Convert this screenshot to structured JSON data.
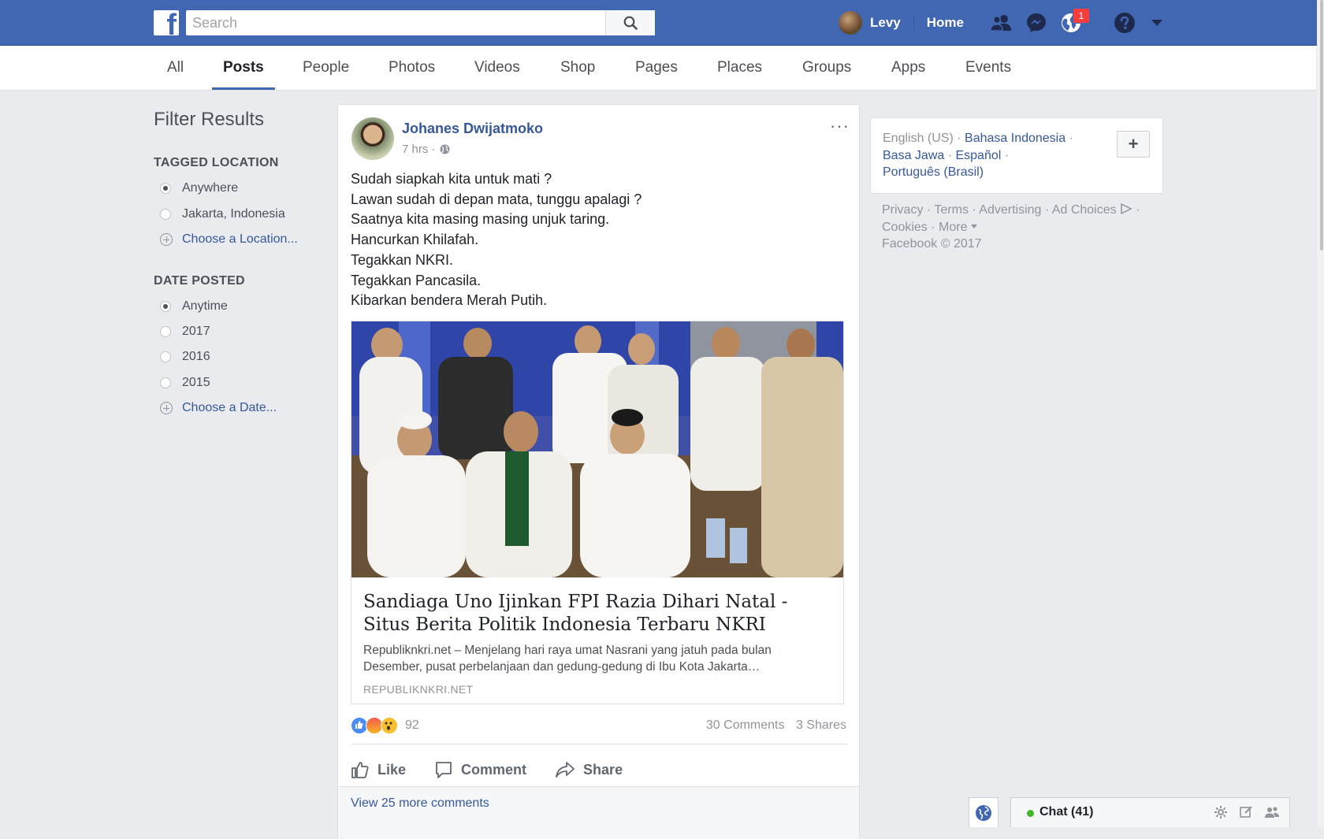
{
  "topbar": {
    "logo_letter": "f",
    "search_placeholder": "Search",
    "user_name": "Levy",
    "home_label": "Home",
    "notifications_count": "1"
  },
  "tabs": [
    {
      "label": "All"
    },
    {
      "label": "Posts"
    },
    {
      "label": "People"
    },
    {
      "label": "Photos"
    },
    {
      "label": "Videos"
    },
    {
      "label": "Shop"
    },
    {
      "label": "Pages"
    },
    {
      "label": "Places"
    },
    {
      "label": "Groups"
    },
    {
      "label": "Apps"
    },
    {
      "label": "Events"
    }
  ],
  "filters": {
    "title": "Filter Results",
    "location": {
      "heading": "TAGGED LOCATION",
      "options": [
        "Anywhere",
        "Jakarta, Indonesia"
      ],
      "choose": "Choose a Location..."
    },
    "date": {
      "heading": "DATE POSTED",
      "options": [
        "Anytime",
        "2017",
        "2016",
        "2015"
      ],
      "choose": "Choose a Date..."
    }
  },
  "post": {
    "author": "Johanes Dwijatmoko",
    "time": "7 hrs ·",
    "more": "···",
    "lines": [
      "Sudah siapkah kita untuk mati ?",
      "Lawan sudah di depan mata, tunggu apalagi ?",
      "Saatnya kita masing masing unjuk taring.",
      "Hancurkan Khilafah.",
      "Tegakkan NKRI.",
      "Tegakkan Pancasila.",
      "Kibarkan bendera Merah Putih."
    ],
    "link": {
      "title": "Sandiaga Uno Ijinkan FPI Razia Dihari Natal - Situs Berita Politik Indonesia Terbaru NKRI",
      "description": "Republiknkri.net – Menjelang hari raya umat Nasrani yang jatuh pada bulan Desember, pusat perbelanjaan dan gedung-gedung di Ibu Kota Jakarta…",
      "domain": "REPUBLIKNKRI.NET"
    },
    "reaction_count": "92",
    "comments": "30 Comments",
    "shares": "3 Shares",
    "actions": {
      "like": "Like",
      "comment": "Comment",
      "share": "Share"
    },
    "view_more": "View 25 more comments"
  },
  "languages": {
    "current": "English (US)",
    "sep": " · ",
    "others": [
      "Bahasa Indonesia",
      "Basa Jawa",
      "Español",
      "Português (Brasil)"
    ],
    "add": "+"
  },
  "footer": {
    "links": [
      "Privacy",
      "Terms",
      "Advertising",
      "Ad Choices",
      "Cookies",
      "More"
    ],
    "copyright": "Facebook © 2017"
  },
  "chat": {
    "label": "Chat (41)"
  },
  "colors": {
    "brand": "#4267b2",
    "link": "#365899",
    "online": "#42b72a",
    "badge": "#fa3e3e"
  }
}
